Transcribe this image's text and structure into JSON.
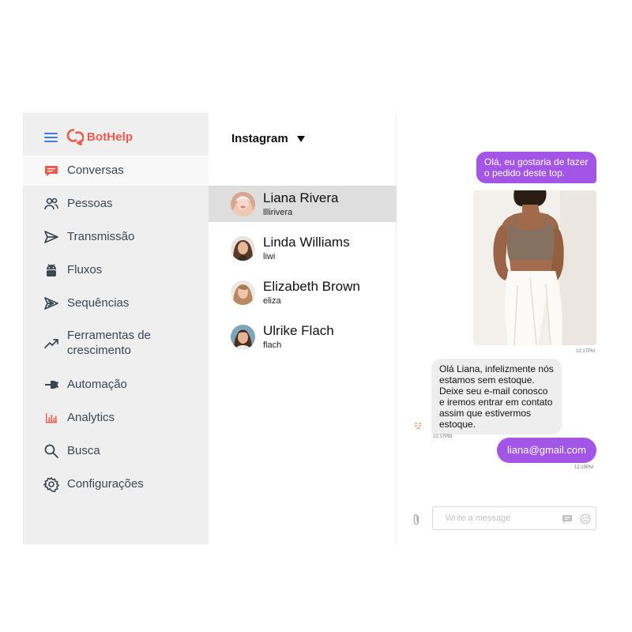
{
  "brand": {
    "name": "BotHelp",
    "color": "#ef5a4c"
  },
  "sidebar": {
    "items": [
      {
        "label": "Conversas",
        "icon": "chat-bubble-icon",
        "active": true
      },
      {
        "label": "Pessoas",
        "icon": "people-icon"
      },
      {
        "label": "Transmissão",
        "icon": "send-icon"
      },
      {
        "label": "Fluxos",
        "icon": "android-robot-icon"
      },
      {
        "label": "Sequências",
        "icon": "sequence-icon"
      },
      {
        "label": "Ferramentas de crescimento",
        "icon": "trend-up-icon"
      },
      {
        "label": "Automação",
        "icon": "plug-icon"
      },
      {
        "label": "Analytics",
        "icon": "bar-chart-icon"
      },
      {
        "label": "Busca",
        "icon": "search-icon"
      },
      {
        "label": "Configurações",
        "icon": "gear-icon"
      }
    ]
  },
  "channel": {
    "selected": "Instagram"
  },
  "contacts": [
    {
      "name": "Liana Rivera",
      "handle": "lllirivera",
      "selected": true
    },
    {
      "name": "Linda Williams",
      "handle": "liwi"
    },
    {
      "name": "Elizabeth Brown",
      "handle": "eliza"
    },
    {
      "name": "Ulrike Flach",
      "handle": "flach"
    }
  ],
  "chat": {
    "messages": [
      {
        "direction": "out",
        "text": "Olá, eu gostaria de fazer o pedido deste top."
      },
      {
        "direction": "out",
        "type": "image",
        "image": "woman-in-brown-crop-top-photo",
        "time": "12:17PM"
      },
      {
        "direction": "in",
        "text": "Olá Liana, infelizmente nós estamos sem estoque. Deixe seu e-mail conosco e iremos entrar em contato assim que estivermos estoque.",
        "time": "12:17PM"
      },
      {
        "direction": "out",
        "text": "liana@gmail.com",
        "time": "12:19PM"
      }
    ],
    "composer": {
      "placeholder": "Write a message"
    }
  },
  "colors": {
    "outgoing_bubble": "#a356e6",
    "incoming_bubble": "#eeeeee",
    "sidebar_bg": "#efefef",
    "selected_row": "#dedede",
    "accent_blue": "#3d7dde"
  }
}
